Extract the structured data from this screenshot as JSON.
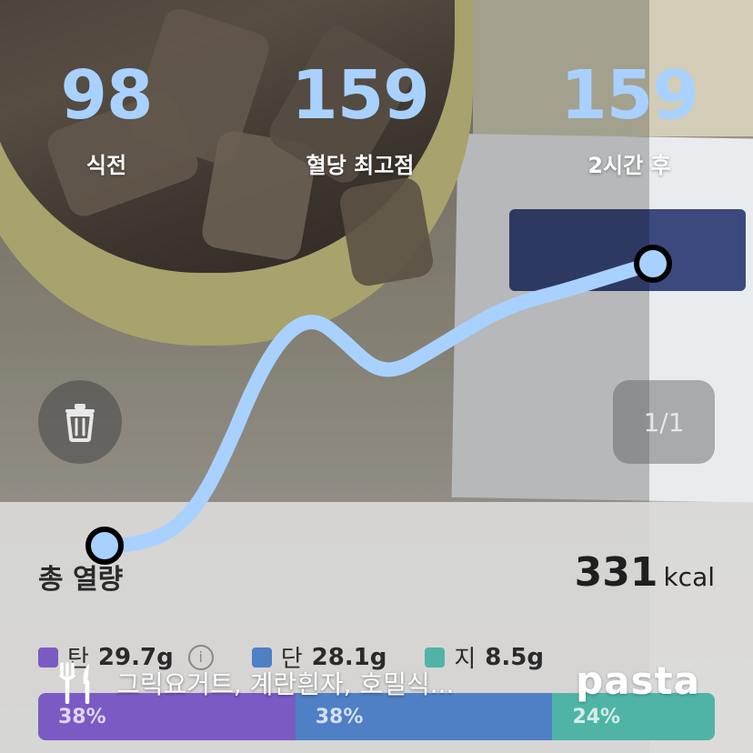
{
  "stats": [
    {
      "value": "98",
      "label": "식전"
    },
    {
      "value": "159",
      "label": "혈당 최고점"
    },
    {
      "value": "159",
      "label": "2시간 후"
    }
  ],
  "photo_counter": "1/1",
  "summary": {
    "title": "총 열량",
    "kcal_value": "331",
    "kcal_unit": "kcal"
  },
  "macros": [
    {
      "name": "탄",
      "value": "29.7g",
      "color": "#7b5ac3",
      "percent": 38,
      "percent_label": "38%"
    },
    {
      "name": "단",
      "value": "28.1g",
      "color": "#4f7fc4",
      "percent": 38,
      "percent_label": "38%"
    },
    {
      "name": "지",
      "value": "8.5g",
      "color": "#4fb4a6",
      "percent": 24,
      "percent_label": "24%"
    }
  ],
  "meal_text": "그릭요거트, 계란흰자, 호밀식...",
  "logo": "pasta",
  "colors": {
    "curve": "#a8d1ff",
    "stat_value": "#a8d1ff"
  },
  "icons": {
    "delete": "trash-icon",
    "meal": "fork-knife-icon",
    "info": "info-icon"
  }
}
